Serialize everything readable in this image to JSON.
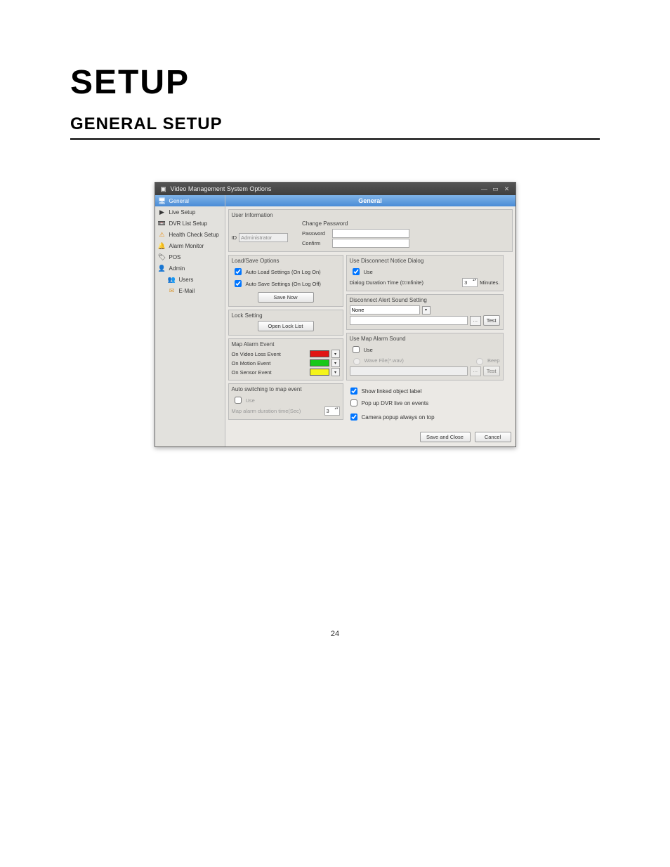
{
  "page": {
    "h1": "SETUP",
    "h2": "GENERAL SETUP",
    "page_number": "24"
  },
  "dialog": {
    "title": "Video Management System Options",
    "panel_header": "General",
    "sidebar": {
      "items": [
        {
          "label": "General",
          "icon": "🖥",
          "selected": true
        },
        {
          "label": "Live Setup",
          "icon": "▶"
        },
        {
          "label": "DVR List Setup",
          "icon": "📼"
        },
        {
          "label": "Health Check Setup",
          "icon": "⚠"
        },
        {
          "label": "Alarm Monitor",
          "icon": "🔔"
        },
        {
          "label": "POS",
          "icon": "🏷"
        },
        {
          "label": "Admin",
          "icon": "👤"
        },
        {
          "label": "Users",
          "icon": "👥",
          "indent": true
        },
        {
          "label": "E-Mail",
          "icon": "✉",
          "indent": true
        }
      ]
    },
    "user_info": {
      "title": "User Information",
      "id_label": "ID",
      "id_value": "Administrator",
      "change_pw_title": "Change Password",
      "password_label": "Password",
      "confirm_label": "Confirm"
    },
    "load_save": {
      "title": "Load/Save Options",
      "auto_load": "Auto Load Settings (On Log On)",
      "auto_save": "Auto Save Settings (On Log Off)",
      "save_now": "Save Now"
    },
    "lock": {
      "title": "Lock Setting",
      "open": "Open Lock List"
    },
    "map_alarm": {
      "title": "Map Alarm Event",
      "video_loss": "On Video Loss Event",
      "motion": "On Motion Event",
      "sensor": "On Sensor Event",
      "colors": {
        "video_loss": "#e11414",
        "motion": "#18c818",
        "sensor": "#f4f41a"
      }
    },
    "auto_switch": {
      "title": "Auto switching to map event",
      "use": "Use",
      "duration_label": "Map alarm duration time(Sec)",
      "duration_value": "3"
    },
    "disconnect_dialog": {
      "title": "Use Disconnect Notice Dialog",
      "use": "Use",
      "duration_label": "Dialog Duration Time (0:Infinite)",
      "duration_value": "3",
      "minutes": "Minutes."
    },
    "disconnect_sound": {
      "title": "Disconnect Alert Sound Setting",
      "selected": "None",
      "test": "Test"
    },
    "map_sound": {
      "title": "Use Map Alarm Sound",
      "use": "Use",
      "wave": "Wave File(*.wav)",
      "beep": "Beep",
      "test": "Test"
    },
    "checks": {
      "show_linked": "Show linked object label",
      "popup_dvr": "Pop up DVR live on events",
      "camera_on_top": "Camera popup always on top"
    },
    "footer": {
      "save": "Save and Close",
      "cancel": "Cancel"
    }
  }
}
